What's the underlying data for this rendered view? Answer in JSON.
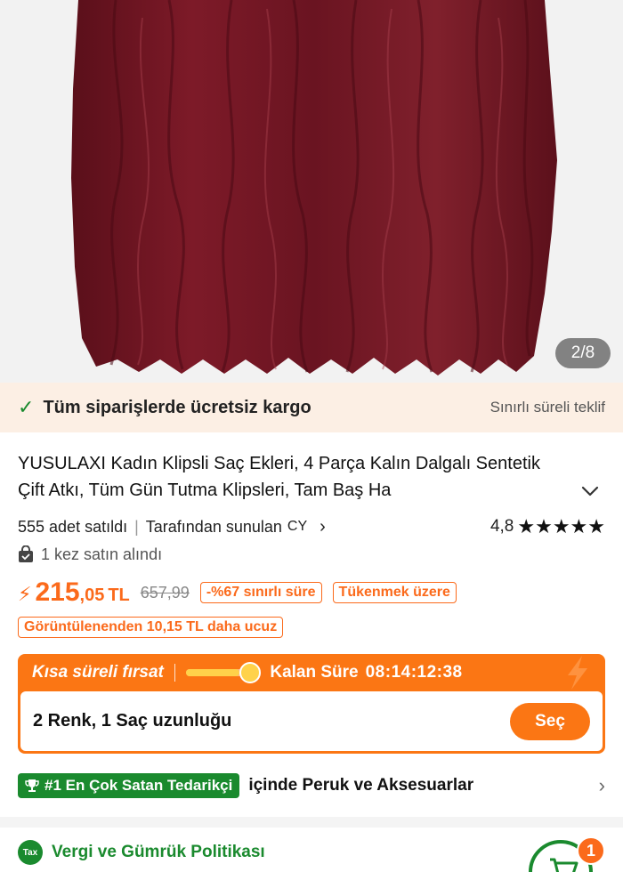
{
  "gallery": {
    "counter": "2/8"
  },
  "shipping": {
    "label": "Tüm siparişlerde ücretsiz kargo",
    "offer": "Sınırlı süreli teklif"
  },
  "product": {
    "title": "YUSULAXI Kadın Klipsli Saç Ekleri, 4 Parça Kalın Dalgalı Sentetik Çift Atkı, Tüm Gün Tutma Klipsleri, Tam Baş Ha",
    "sold": "555 adet satıldı",
    "sold_by": "Tarafından sunulan",
    "seller_country": "CY",
    "rating": "4,8",
    "stars": "★★★★★",
    "bought": "1 kez satın alındı"
  },
  "price": {
    "main": "215",
    "decimals": ",05",
    "currency": "TL",
    "old": "657,99",
    "discount_tag": "-%67 sınırlı süre",
    "stock_tag": "Tükenmek üzere",
    "cheaper_tag": "Görüntülenenden 10,15 TL daha ucuz"
  },
  "deal": {
    "name": "Kısa süreli fırsat",
    "progress": 0.85,
    "remaining_label": "Kalan Süre",
    "time": "08:14:12:38",
    "variants": "2 Renk, 1 Saç uzunluğu",
    "select_label": "Seç"
  },
  "best_seller": {
    "badge": "#1 En Çok Satan Tedarikçi",
    "category": "içinde Peruk ve Aksesuarlar"
  },
  "tax": {
    "icon_text": "Tax",
    "label": "Vergi ve Gümrük Politikası"
  },
  "cart": {
    "count": "1"
  },
  "colors": {
    "accent": "#fb6a1b",
    "green": "#1a8a2e",
    "hair": "#6e1420"
  }
}
